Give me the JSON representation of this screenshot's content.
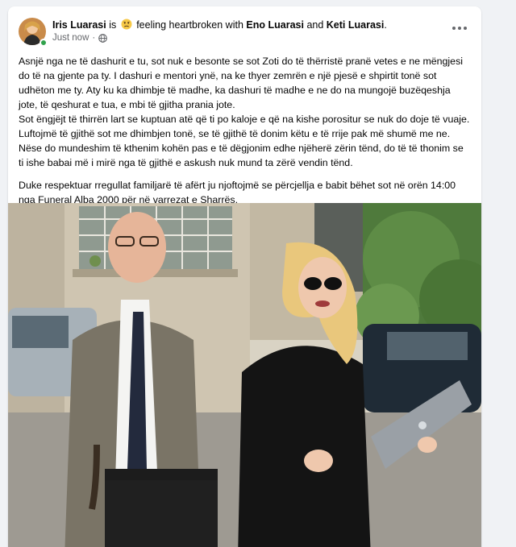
{
  "post": {
    "author": "Iris Luarasi",
    "is_text": "is",
    "feeling_text": "feeling heartbroken with",
    "tag1": "Eno Luarasi",
    "and_text": "and",
    "tag2": "Keti Luarasi",
    "end_punct": ".",
    "time": "Just now",
    "time_sep": "·",
    "paragraphs": [
      "Asnjë nga ne të dashurit e tu, sot nuk e besonte se sot Zoti do të thërristë pranë vetes e ne mëngjesi do të na gjente pa ty. I dashuri e mentori ynë, na ke thyer zemrën e një pjesë e shpirtit tonë sot udhëton me ty. Aty ku ka dhimbje të madhe, ka dashuri të madhe e ne do na mungojë buzëqeshja jote, të qeshurat e tua, e mbi të gjitha prania jote.",
      "Sot ëngjëjt të thirrën lart se kuptuan atë që ti po kaloje e që na kishe porositur se nuk do doje të vuaje. Luftojmë të gjithë sot me dhimbjen tonë, se të gjithë të donim këtu e të rrije pak më shumë me ne. Nëse do mundeshim të kthenim kohën pas e të dëgjonim edhe njëherë zërin tënd, do të të thonim se ti ishe babai më i mirë nga të gjithë e askush nuk mund ta zërë vendin tënd.",
      "Duke respektuar rregullat familjarë të afërt ju njoftojmë se përcjellja e babit bëhet sot në orën 14:00 nga Funeral Alba 2000 për në varrezat e Sharrës."
    ]
  },
  "icons": {
    "avatar": "profile-photo",
    "feeling": "sad-face-emoji",
    "privacy": "globe-icon",
    "more": "more-options-icon"
  },
  "colors": {
    "background": "#f0f2f5",
    "card": "#ffffff",
    "text": "#050505",
    "secondary": "#65676b",
    "online": "#31a24c"
  }
}
